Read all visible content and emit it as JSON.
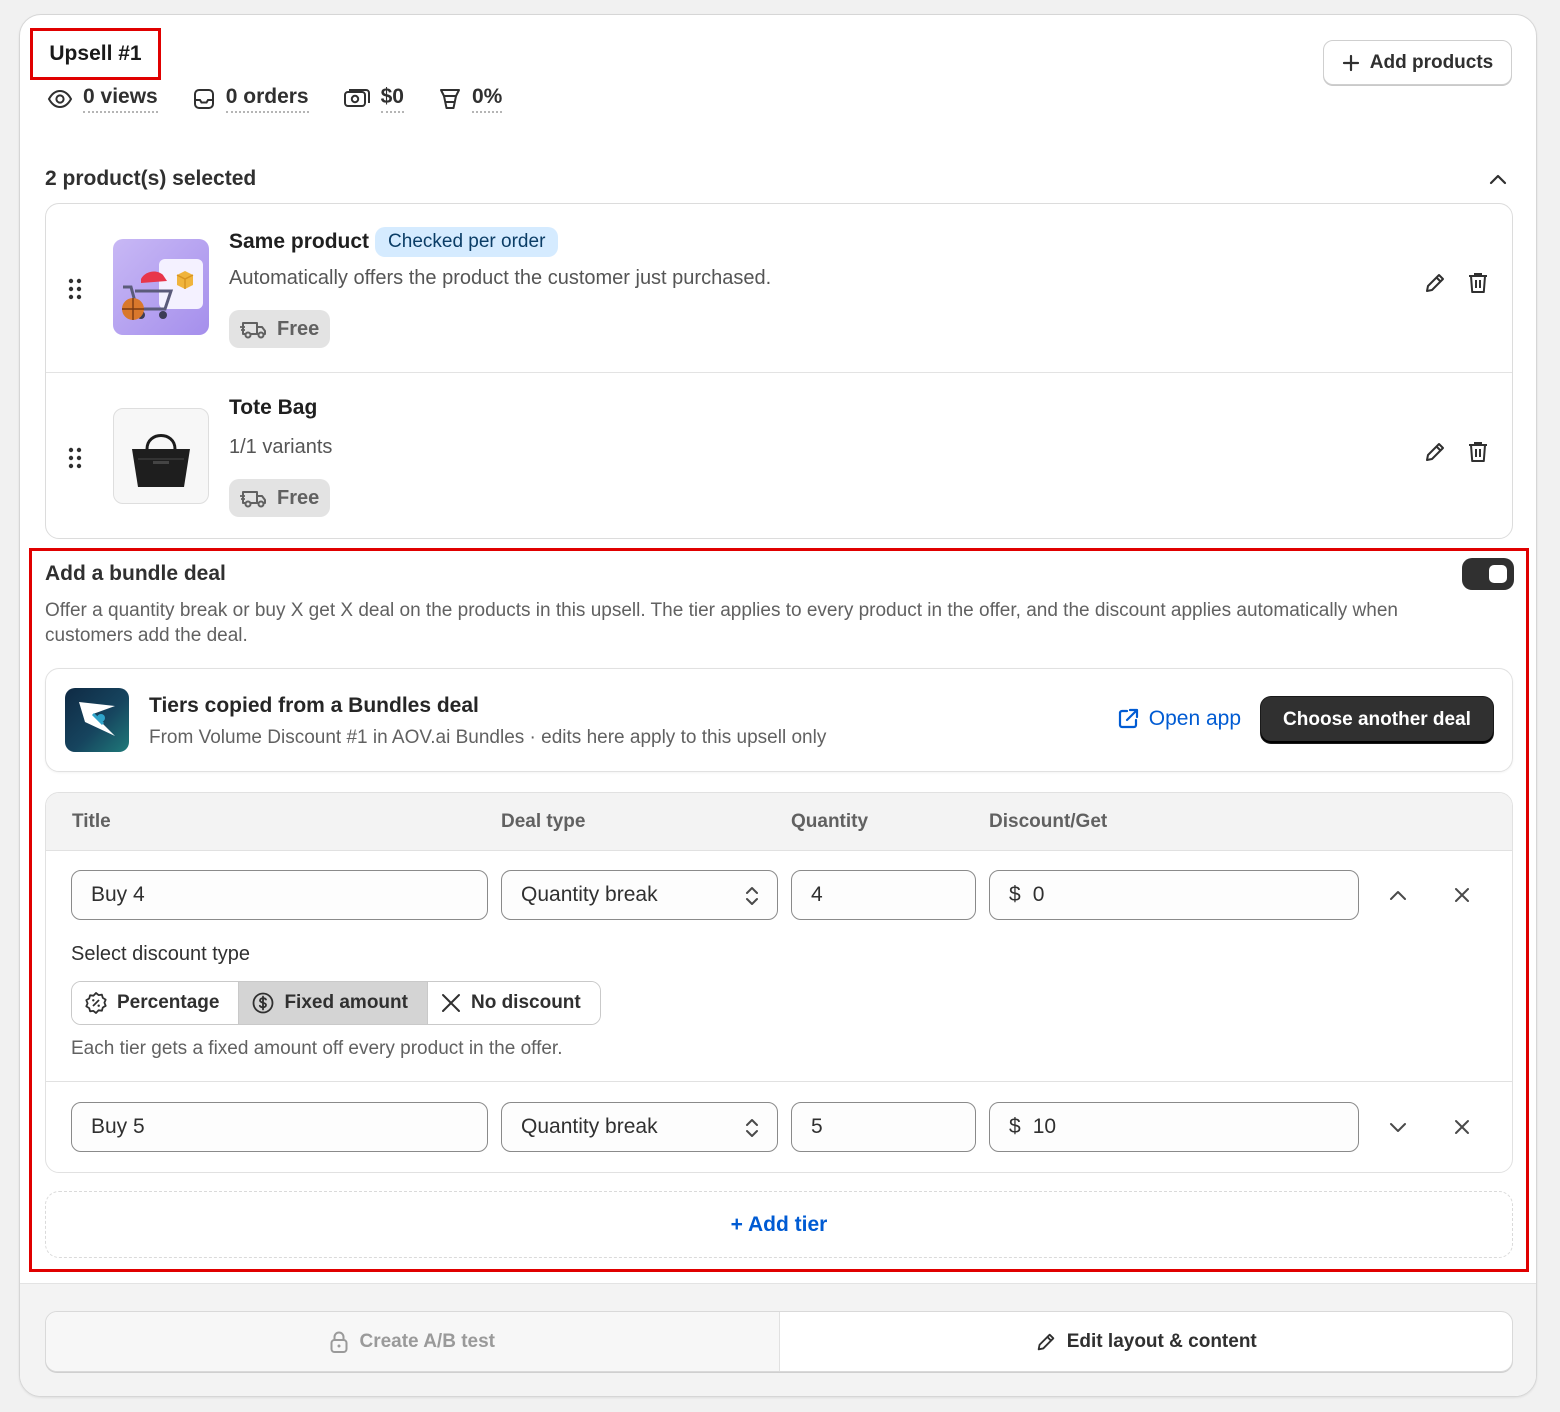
{
  "upsell": {
    "title": "Upsell #1",
    "add_products_label": "Add products",
    "stats": {
      "views": "0 views",
      "orders": "0 orders",
      "revenue": "$0",
      "conversion": "0%"
    }
  },
  "products": {
    "selected_label": "2 product(s) selected",
    "items": [
      {
        "name": "Same product",
        "badge": "Checked per order",
        "description": "Automatically offers the product the customer just purchased.",
        "shipping": "Free"
      },
      {
        "name": "Tote Bag",
        "description": "1/1 variants",
        "shipping": "Free"
      }
    ]
  },
  "bundle": {
    "title": "Add a bundle deal",
    "enabled": true,
    "description": "Offer a quantity break or buy X get X deal on the products in this upsell. The tier applies to every product in the offer, and the discount applies automatically when customers add the deal.",
    "source": {
      "title": "Tiers copied from a Bundles deal",
      "subtitle": "From Volume Discount #1 in AOV.ai Bundles · edits here apply to this upsell only",
      "open_app_label": "Open app",
      "choose_label": "Choose another deal"
    },
    "columns": {
      "title": "Title",
      "deal_type": "Deal type",
      "quantity": "Quantity",
      "discount": "Discount/Get"
    },
    "tiers": [
      {
        "title": "Buy 4",
        "deal_type": "Quantity break",
        "quantity": "4",
        "currency": "$",
        "discount": "0"
      },
      {
        "title": "Buy 5",
        "deal_type": "Quantity break",
        "quantity": "5",
        "currency": "$",
        "discount": "10"
      }
    ],
    "discount_type": {
      "label": "Select discount type",
      "options": [
        "Percentage",
        "Fixed amount",
        "No discount"
      ],
      "selected": "Fixed amount",
      "help": "Each tier gets a fixed amount off every product in the offer."
    },
    "add_tier_label": "+ Add tier"
  },
  "footer": {
    "ab_test_label": "Create A/B test",
    "edit_layout_label": "Edit layout & content"
  },
  "colors": {
    "accent_link": "#005bd3",
    "highlight_border": "#e00000",
    "primary_dark": "#303030"
  }
}
